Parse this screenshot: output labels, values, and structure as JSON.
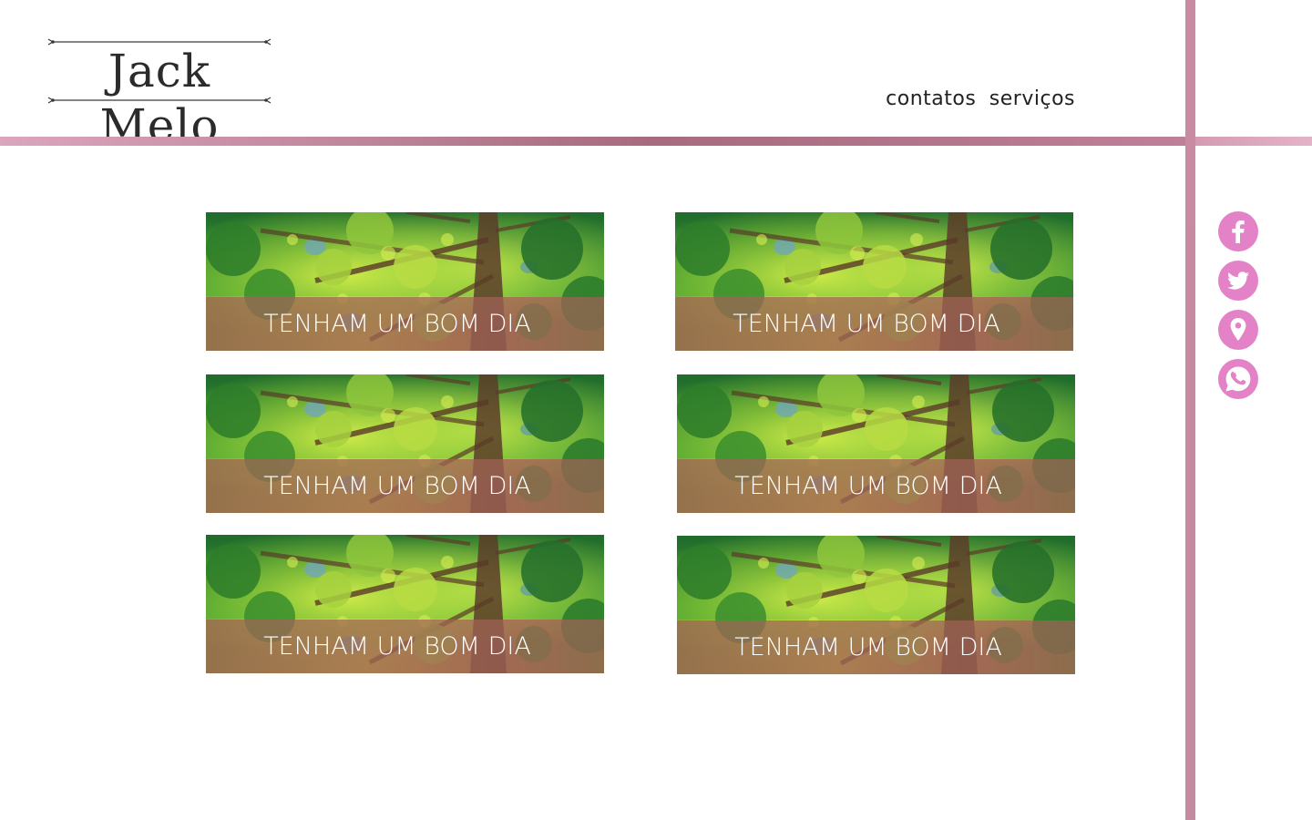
{
  "brand": {
    "name": "Jack Melo"
  },
  "nav": {
    "items": [
      {
        "label": "contatos"
      },
      {
        "label": "serviços"
      }
    ]
  },
  "social": [
    {
      "icon": "facebook-icon"
    },
    {
      "icon": "twitter-icon"
    },
    {
      "icon": "location-pin-icon"
    },
    {
      "icon": "whatsapp-icon"
    }
  ],
  "cards": [
    {
      "label": "TENHAM UM BOM DIA"
    },
    {
      "label": "TENHAM UM BOM DIA"
    },
    {
      "label": "TENHAM UM BOM DIA"
    },
    {
      "label": "TENHAM UM BOM DIA"
    },
    {
      "label": "TENHAM UM BOM DIA"
    },
    {
      "label": "TENHAM UM BOM DIA"
    }
  ],
  "colors": {
    "accent_pink": "#e382c7",
    "bar_mauve": "#c38aa0",
    "band_brown": "#a06258",
    "foliage_green": "#2f8a2a"
  }
}
